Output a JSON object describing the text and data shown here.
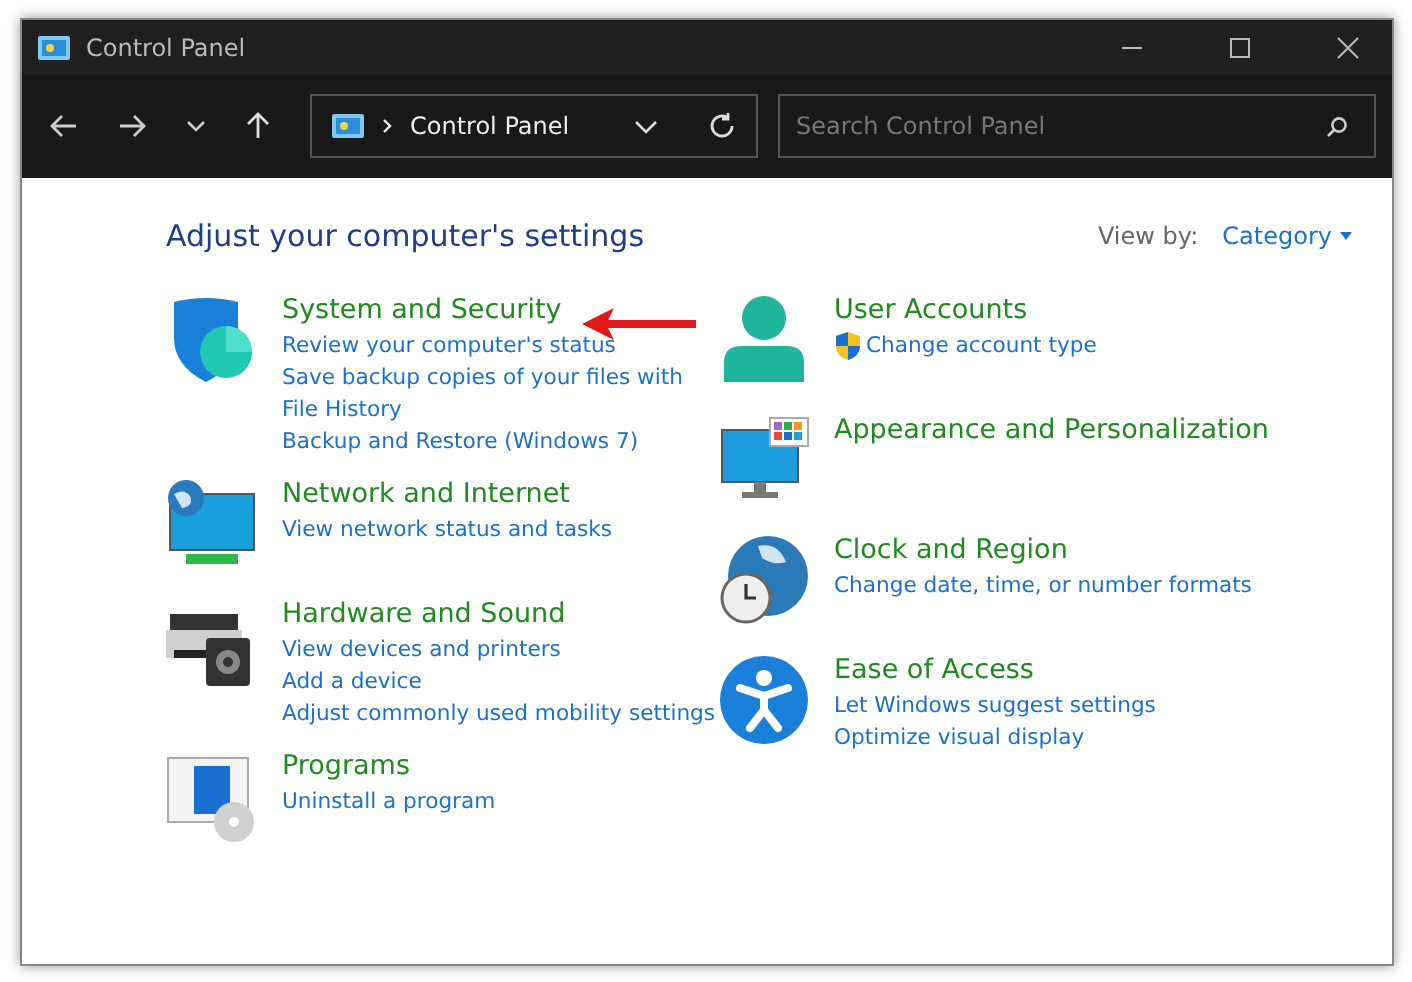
{
  "window": {
    "title": "Control Panel"
  },
  "address_bar": {
    "path": "Control Panel"
  },
  "search": {
    "placeholder": "Search Control Panel"
  },
  "heading": "Adjust your computer's settings",
  "view_by": {
    "label": "View by:",
    "value": "Category"
  },
  "columns": [
    [
      {
        "title": "System and Security",
        "kind": "shield",
        "links": [
          {
            "text": "Review your computer's status",
            "shield": false
          },
          {
            "text": "Save backup copies of your files with File History",
            "shield": false
          },
          {
            "text": "Backup and Restore (Windows 7)",
            "shield": false
          }
        ]
      },
      {
        "title": "Network and Internet",
        "kind": "network",
        "links": [
          {
            "text": "View network status and tasks",
            "shield": false
          }
        ]
      },
      {
        "title": "Hardware and Sound",
        "kind": "printer",
        "links": [
          {
            "text": "View devices and printers",
            "shield": false
          },
          {
            "text": "Add a device",
            "shield": false
          },
          {
            "text": "Adjust commonly used mobility settings",
            "shield": false
          }
        ]
      },
      {
        "title": "Programs",
        "kind": "programs",
        "links": [
          {
            "text": "Uninstall a program",
            "shield": false
          }
        ]
      }
    ],
    [
      {
        "title": "User Accounts",
        "kind": "user",
        "links": [
          {
            "text": "Change account type",
            "shield": true
          }
        ]
      },
      {
        "title": "Appearance and Personalization",
        "kind": "monitor"
      },
      {
        "title": "Clock and Region",
        "kind": "clock",
        "links": [
          {
            "text": "Change date, time, or number formats",
            "shield": false
          }
        ]
      },
      {
        "title": "Ease of Access",
        "kind": "access",
        "links": [
          {
            "text": "Let Windows suggest settings",
            "shield": false
          },
          {
            "text": "Optimize visual display",
            "shield": false
          }
        ]
      }
    ]
  ]
}
